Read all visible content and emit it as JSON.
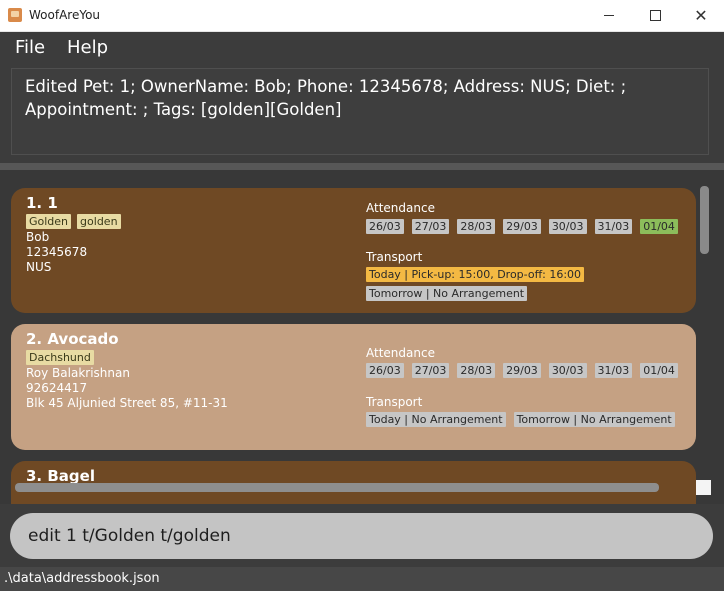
{
  "window": {
    "title": "WoofAreYou"
  },
  "menu": {
    "file": "File",
    "help": "Help"
  },
  "result": {
    "text": "Edited Pet: 1; OwnerName: Bob; Phone: 12345678; Address: NUS; Diet: ; Appointment: ; Tags: [golden][Golden]"
  },
  "labels": {
    "attendance": "Attendance",
    "transport": "Transport"
  },
  "pets": [
    {
      "title": "1.  1",
      "tags": [
        "Golden",
        "golden"
      ],
      "owner": "Bob",
      "phone": "12345678",
      "address": "NUS",
      "attendance": [
        "26/03",
        "27/03",
        "28/03",
        "29/03",
        "30/03",
        "31/03",
        "01/04"
      ],
      "transport": [
        "Today | Pick-up: 15:00, Drop-off: 16:00",
        "Tomorrow | No Arrangement"
      ]
    },
    {
      "title": "2.  Avocado",
      "tags": [
        "Dachshund"
      ],
      "owner": "Roy Balakrishnan",
      "phone": "92624417",
      "address": "Blk 45 Aljunied Street 85, #11-31",
      "attendance": [
        "26/03",
        "27/03",
        "28/03",
        "29/03",
        "30/03",
        "31/03",
        "01/04"
      ],
      "transport": [
        "Today | No Arrangement",
        "Tomorrow | No Arrangement"
      ]
    },
    {
      "title": "3.  Bagel"
    }
  ],
  "command": {
    "value": "edit 1 t/Golden t/golden"
  },
  "status": {
    "path": ".\\data\\addressbook.json"
  },
  "colors": {
    "card_brown": "#6f4924",
    "card_tan": "#c5a183",
    "present": "#8cbd5b",
    "today": "#f4b943"
  }
}
